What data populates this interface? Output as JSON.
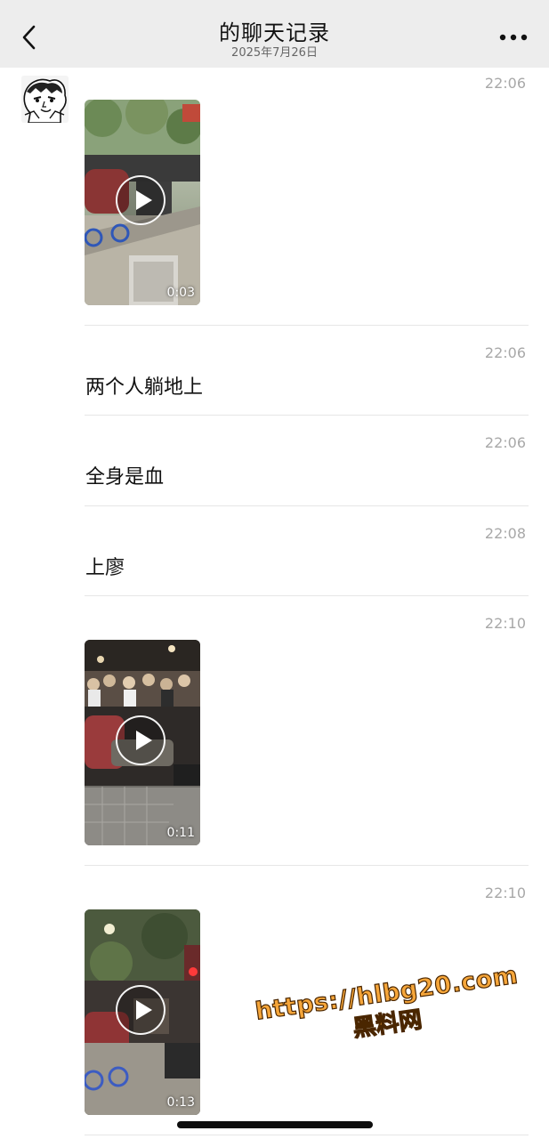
{
  "header": {
    "title": "的聊天记录",
    "date": "2025年7月26日"
  },
  "icons": {
    "back": "chevron-left-icon",
    "more": "more-dots-icon",
    "play": "play-icon"
  },
  "colors": {
    "header_bg": "#ededed",
    "time_text": "#a8a8a8",
    "watermark_fill": "#f6a63a"
  },
  "messages": [
    {
      "type": "video",
      "time": "22:06",
      "duration": "0:03"
    },
    {
      "type": "text",
      "time": "22:06",
      "text": "两个人躺地上"
    },
    {
      "type": "text",
      "time": "22:06",
      "text": "全身是血"
    },
    {
      "type": "text",
      "time": "22:08",
      "text": "上廖"
    },
    {
      "type": "video",
      "time": "22:10",
      "duration": "0:11"
    },
    {
      "type": "video",
      "time": "22:10",
      "duration": "0:13"
    }
  ],
  "watermark": {
    "url": "https://hlbg20.com",
    "name": "黑料网"
  }
}
